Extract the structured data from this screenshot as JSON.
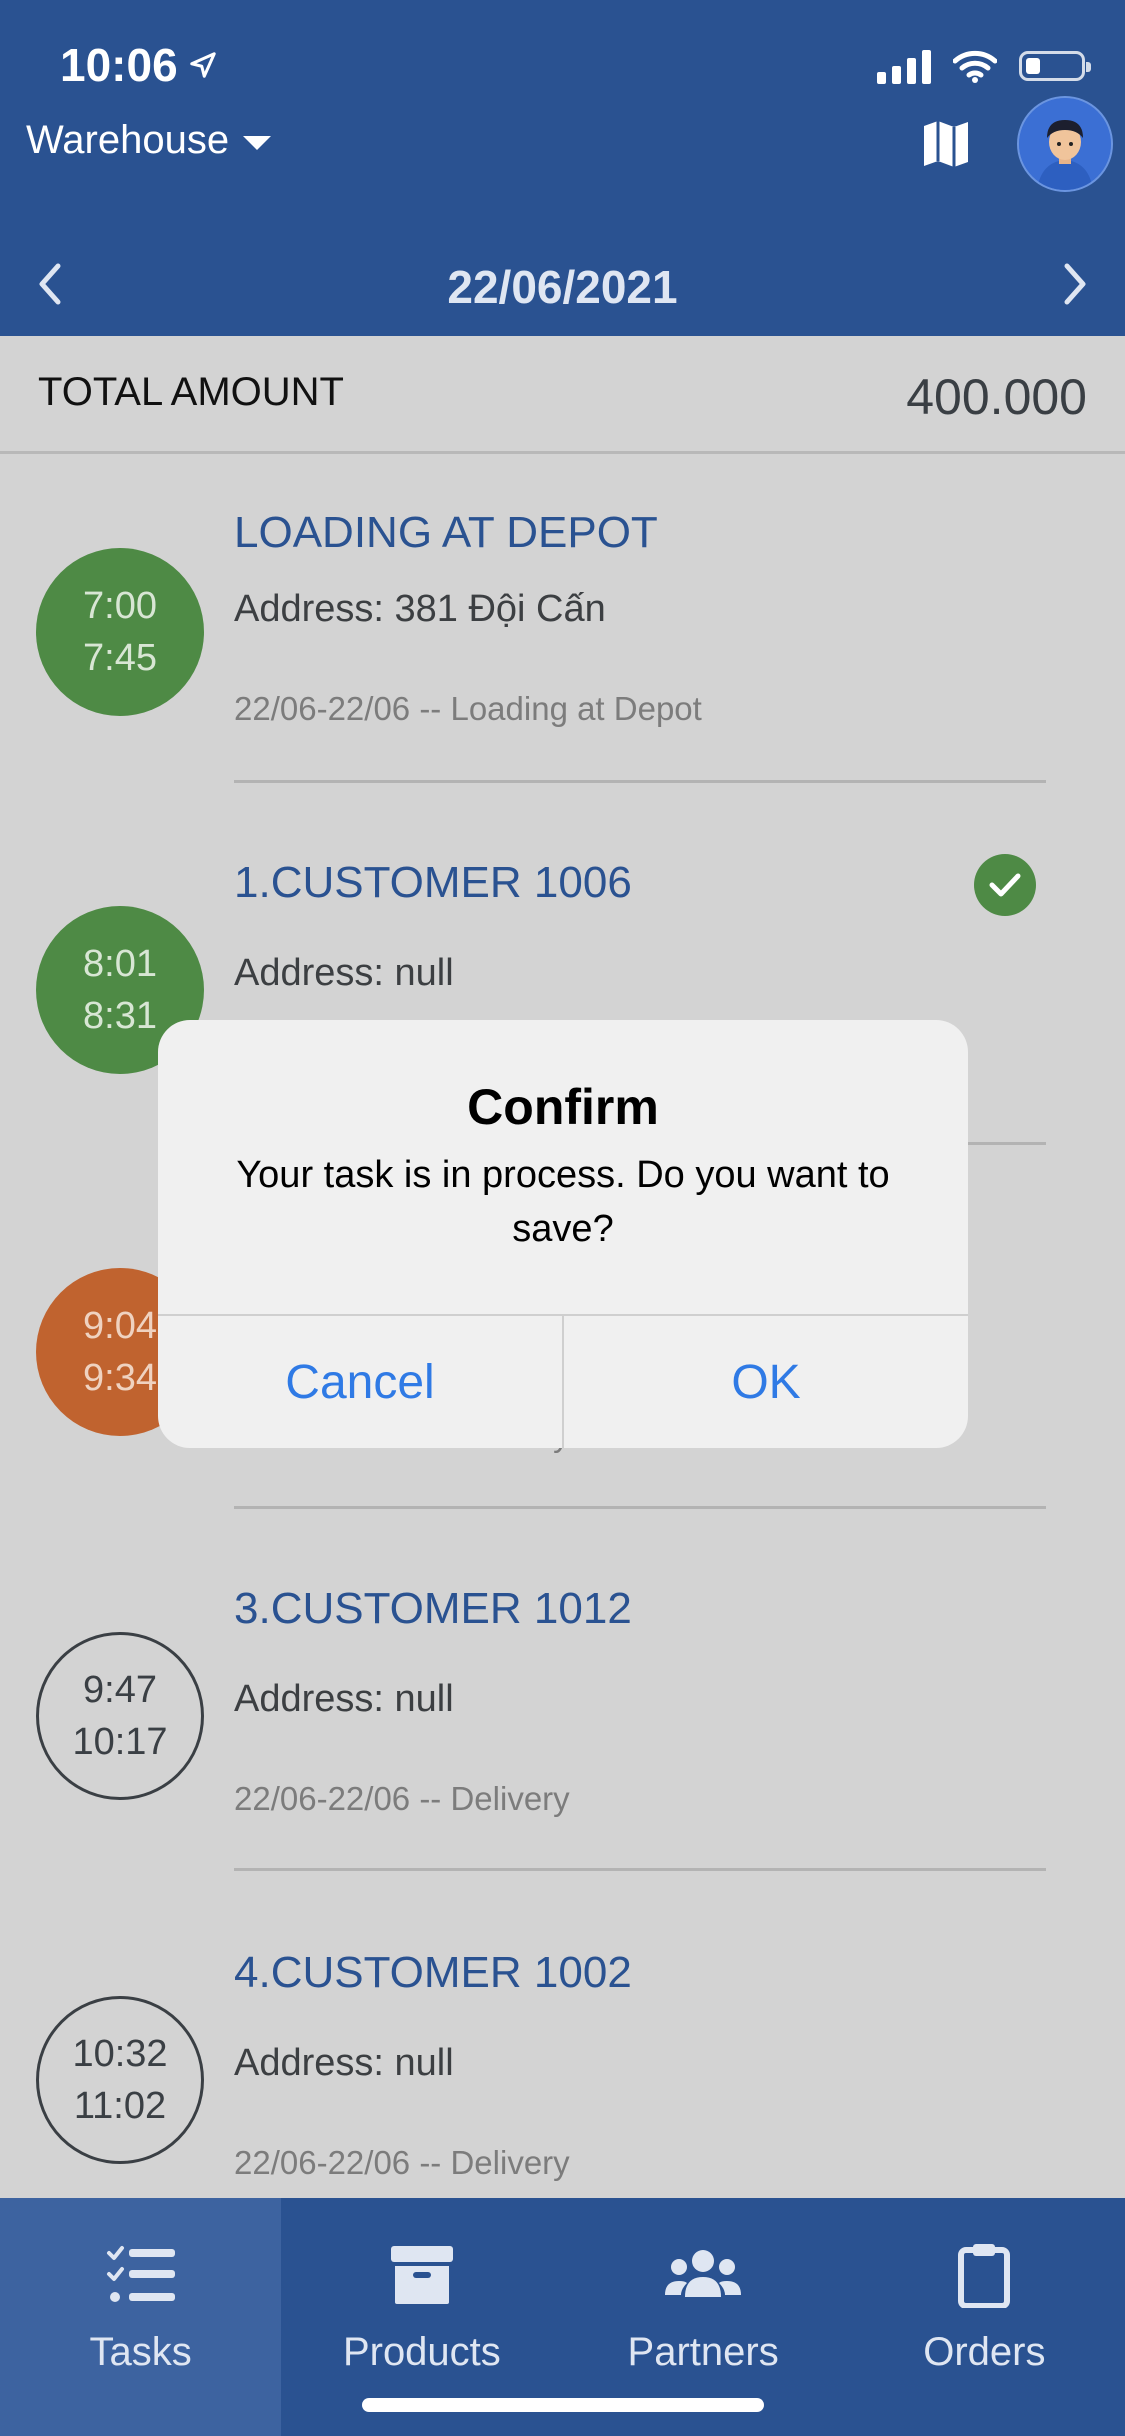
{
  "status_bar": {
    "time": "10:06"
  },
  "header": {
    "warehouse_label": "Warehouse",
    "date": "22/06/2021"
  },
  "summary": {
    "total_label": "TOTAL AMOUNT",
    "total_value": "400.000"
  },
  "tasks": [
    {
      "start": "7:00",
      "end": "7:45",
      "status_color": "green",
      "title": "LOADING AT DEPOT",
      "address": "Address: 381 Đội Cấn",
      "meta": "22/06-22/06 -- Loading at Depot",
      "done": false
    },
    {
      "start": "8:01",
      "end": "8:31",
      "status_color": "green",
      "title": "1.CUSTOMER 1006",
      "address": "Address: null",
      "meta": "",
      "done": true
    },
    {
      "start": "9:04",
      "end": "9:34",
      "status_color": "orange",
      "title": "",
      "address": "",
      "meta": "22/06-22/06 -- Delivery",
      "done": false
    },
    {
      "start": "9:47",
      "end": "10:17",
      "status_color": "outline",
      "title": "3.CUSTOMER 1012",
      "address": "Address: null",
      "meta": "22/06-22/06 -- Delivery",
      "done": false
    },
    {
      "start": "10:32",
      "end": "11:02",
      "status_color": "outline",
      "title": "4.CUSTOMER 1002",
      "address": "Address: null",
      "meta": "22/06-22/06 -- Delivery",
      "done": false
    }
  ],
  "dialog": {
    "title": "Confirm",
    "message": "Your task is in process. Do you want to save?",
    "cancel_label": "Cancel",
    "ok_label": "OK"
  },
  "tabbar": {
    "items": [
      {
        "label": "Tasks",
        "icon": "task-list-icon",
        "active": true
      },
      {
        "label": "Products",
        "icon": "archive-box-icon",
        "active": false
      },
      {
        "label": "Partners",
        "icon": "users-icon",
        "active": false
      },
      {
        "label": "Orders",
        "icon": "clipboard-icon",
        "active": false
      }
    ]
  },
  "colors": {
    "brand": "#2a5291",
    "status_green": "#4e8a45",
    "status_orange": "#c0632f",
    "dialog_action": "#2f7ae5"
  }
}
